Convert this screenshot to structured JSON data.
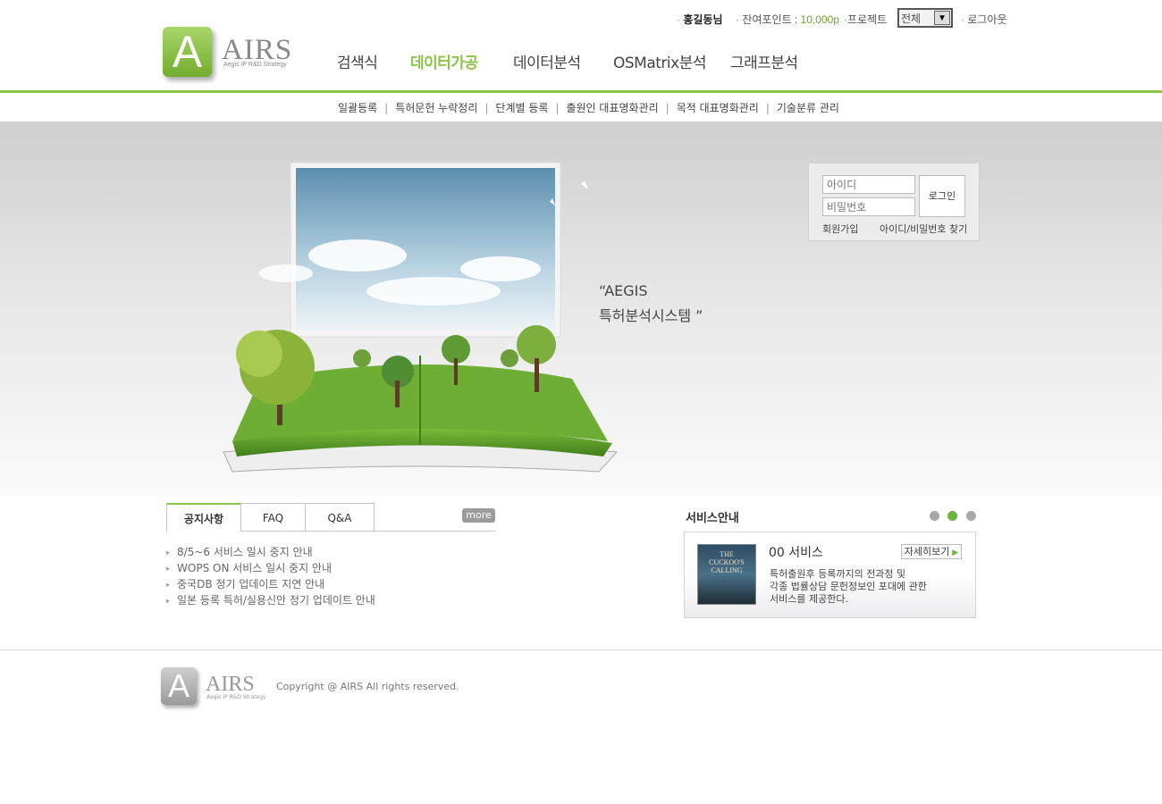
{
  "brand": {
    "logo_letter": "A",
    "name": "AIRS",
    "tagline": "Aegis IP R&D Strategy"
  },
  "topbar": {
    "user": "홍길동님",
    "points_label": "잔여포인트 : ",
    "points_value": "10,000p",
    "project_label": "프로젝트",
    "project_selected": "전체",
    "logout": "로그아웃"
  },
  "main_nav": [
    {
      "label": "검색식",
      "active": false
    },
    {
      "label": "데이터가공",
      "active": true
    },
    {
      "label": "데이터분석",
      "active": false
    },
    {
      "label": "OSMatrix분석",
      "active": false
    },
    {
      "label": "그래프분석",
      "active": false
    }
  ],
  "sub_nav": [
    "일괄등록",
    "특허문헌 누락정리",
    "단계별 등록",
    "출원인 대표명화관리",
    "목적 대표명화관리",
    "기술분류 관리"
  ],
  "hero": {
    "tagline_line1": "“AEGIS",
    "tagline_line2": "특허분석시스템 ”"
  },
  "login": {
    "id_placeholder": "아이디",
    "pw_placeholder": "비밀번호",
    "button": "로그인",
    "signup": "회원가입",
    "find": "아이디/비밀번호 찾기"
  },
  "notice": {
    "tabs": [
      "공지사항",
      "FAQ",
      "Q&A"
    ],
    "more": "more",
    "items": [
      "8/5~6 서비스 일시 중지 안내",
      "WOPS ON 서비스 일시 중지 안내",
      "중국DB 정기 업데이트 지연 안내",
      "일본 등록 특허/실용신안 정기 업데이트 안내"
    ]
  },
  "service": {
    "title": "서비스안내",
    "name": "00 서비스",
    "detail_button": "자세히보기",
    "desc_line1": "특허출원후 등록까지의 전과정 및",
    "desc_line2": "각종 법률상담 문헌정보인 포대에 관한",
    "desc_line3": "서비스를 제공한다.",
    "thumb_text_1": "THE",
    "thumb_text_2": "CUCKOO'S",
    "thumb_text_3": "CALLING",
    "pager_active": 2
  },
  "footer": {
    "copyright": "Copyright @ AIRS All rights reserved."
  }
}
